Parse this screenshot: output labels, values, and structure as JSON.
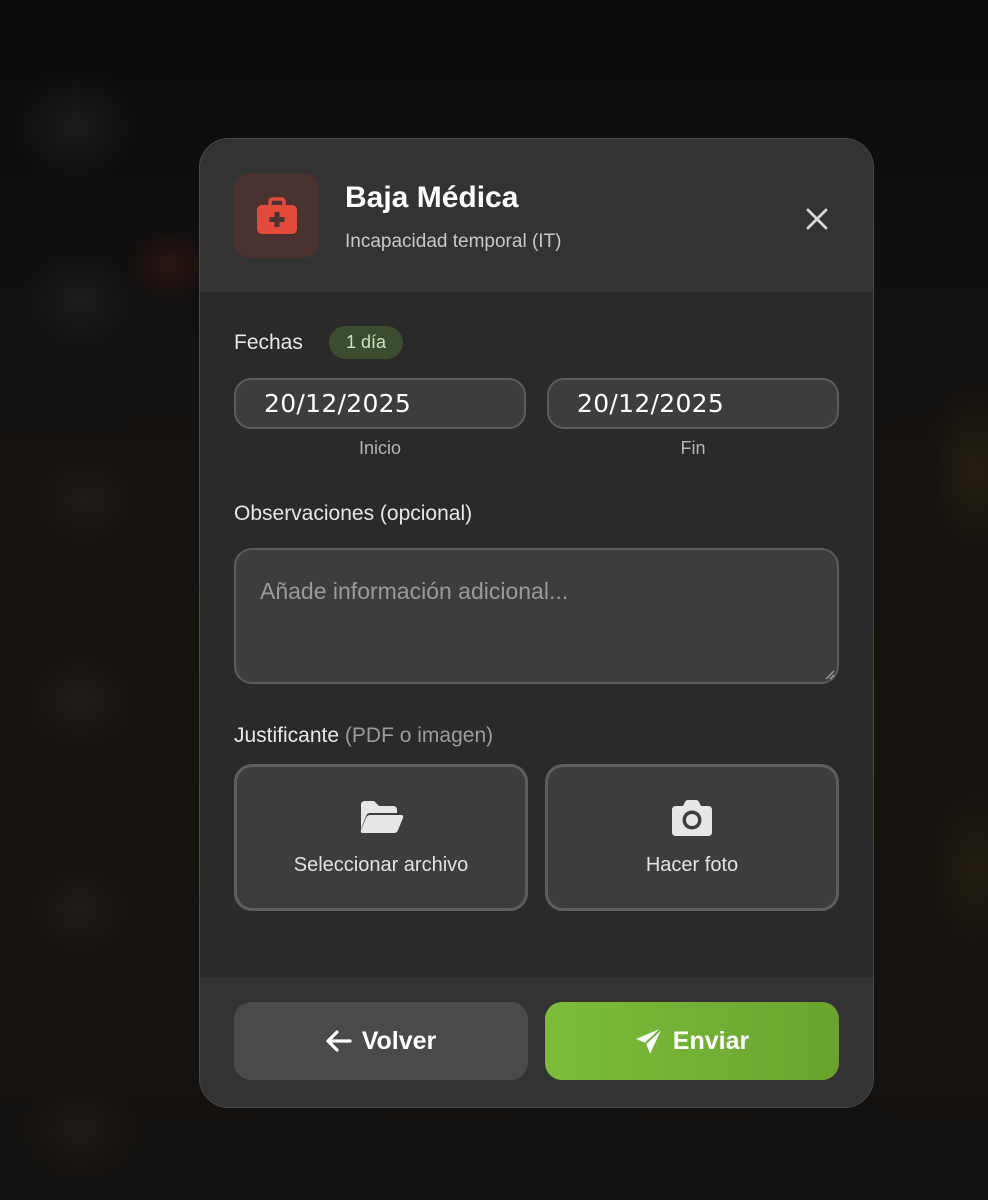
{
  "modal": {
    "title": "Baja Médica",
    "subtitle": "Incapacidad temporal (IT)",
    "header_icon": "medical-kit-icon",
    "close_icon": "close-icon",
    "accent_color": "#e24a3b"
  },
  "dates": {
    "label": "Fechas",
    "duration_badge": "1 día",
    "start": {
      "value": "20/12/2025",
      "caption": "Inicio"
    },
    "end": {
      "value": "20/12/2025",
      "caption": "Fin"
    }
  },
  "observations": {
    "label": "Observaciones (opcional)",
    "placeholder": "Añade información adicional..."
  },
  "attachment": {
    "label": "Justificante",
    "hint": "(PDF o imagen)",
    "select_file": {
      "label": "Seleccionar archivo",
      "icon": "folder-open-icon"
    },
    "take_photo": {
      "label": "Hacer foto",
      "icon": "camera-icon"
    }
  },
  "footer": {
    "back": {
      "label": "Volver",
      "icon": "arrow-left-icon"
    },
    "send": {
      "label": "Enviar",
      "icon": "paper-plane-icon",
      "color": "#76b536"
    }
  }
}
